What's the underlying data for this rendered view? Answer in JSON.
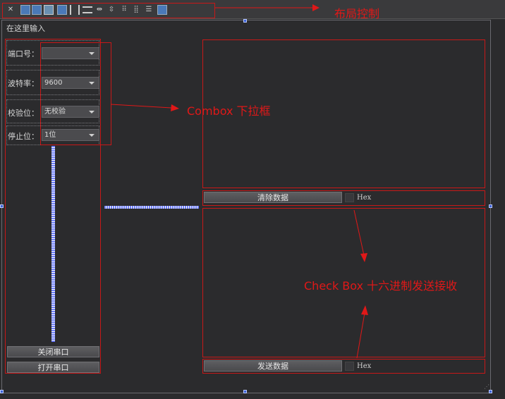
{
  "annotations": {
    "layout_control": "布局控制",
    "combobox": "Combox  下拉框",
    "checkbox": "Check Box  十六进制发送接收"
  },
  "form": {
    "title_placeholder": "在这里输入"
  },
  "serial": {
    "port_label": "端口号：",
    "port_value": "",
    "baud_label": "波特率：",
    "baud_value": "9600",
    "parity_label": "校验位：",
    "parity_value": "无校验",
    "stop_label": "停止位：",
    "stop_value": "1位",
    "close_button": "关闭串口",
    "open_button": "打开串口"
  },
  "receive": {
    "clear_button": "清除数据",
    "hex_label": "Hex"
  },
  "send": {
    "send_button": "发送数据",
    "hex_label": "Hex"
  },
  "colors": {
    "annotation_red": "#e01818",
    "spacer_blue": "#6f7fff"
  }
}
